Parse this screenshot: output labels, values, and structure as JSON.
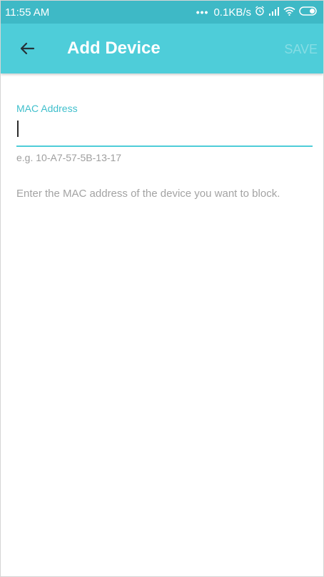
{
  "status_bar": {
    "time": "11:55 AM",
    "network_speed": "0.1KB/s",
    "icons": [
      "more-dots-icon",
      "alarm-icon",
      "signal-icon",
      "wifi-icon",
      "battery-icon"
    ]
  },
  "app_bar": {
    "title": "Add Device",
    "save_label": "SAVE",
    "back_icon": "arrow-left-icon",
    "background_color": "#4ecdd9"
  },
  "form": {
    "mac_label": "MAC Address",
    "mac_value": "",
    "mac_hint": "e.g. 10-A7-57-5B-13-17",
    "description": "Enter the MAC address of the device you want to block."
  },
  "colors": {
    "status_bar": "#3eb9c6",
    "accent": "#4ecdd9",
    "label": "#3fbfcc",
    "hint": "#9e9e9e"
  }
}
